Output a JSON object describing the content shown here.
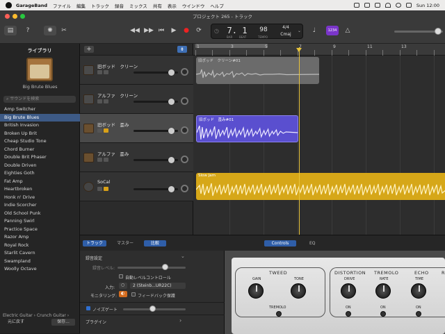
{
  "menubar": {
    "app_name": "GarageBand",
    "items": [
      "ファイル",
      "編集",
      "トラック",
      "録音",
      "ミックス",
      "共有",
      "表示",
      "ウインドウ",
      "ヘルプ"
    ],
    "clock": "Sun 12:00"
  },
  "toolbar": {
    "title": "プロジェクト 265 - トラック",
    "lcd": {
      "position": "7. 1",
      "bar_label": "BAR",
      "beat_label": "BEAT",
      "tempo": "98",
      "tempo_label": "TEMPO",
      "time_signature": "4/4",
      "key": "Cmaj"
    },
    "count_in": "1234"
  },
  "library": {
    "header": "ライブラリ",
    "patch_name": "Big Brute Blues",
    "search_placeholder": "サウンドを検索",
    "items": [
      "Amp Switcher",
      "Big Brute Blues",
      "British Invasion",
      "Broken Up Brit",
      "Cheap Studio Tone",
      "Chord Burner",
      "Double Brit Phaser",
      "Double Driven",
      "Eighties Goth",
      "Fat Amp",
      "Heartbroken",
      "Honk n' Drive",
      "Indie Scorcher",
      "Old School Punk",
      "Panning Swirl",
      "Practice Space",
      "Razor Amp",
      "Royal Rock",
      "Starlit Cavern",
      "Swampland",
      "Woolly Octave"
    ],
    "selected_index": 1,
    "breadcrumb": "Electric Guitar › Crunch Guitar ›",
    "revert_label": "元に戻す",
    "save_label": "保存..."
  },
  "tracks": [
    {
      "name": "旧ボッド　クリーン",
      "selected": false
    },
    {
      "name": "アルファ　クリーン",
      "selected": false
    },
    {
      "name": "旧ボッド　歪み",
      "selected": true
    },
    {
      "name": "アルファ　歪み",
      "selected": false
    },
    {
      "name": "SoCal",
      "selected": false
    }
  ],
  "ruler": {
    "bars": [
      "1",
      "3",
      "5",
      "7",
      "9",
      "11",
      "13"
    ],
    "playhead_bar": 7
  },
  "regions": [
    {
      "label": "旧ボッド　クリーン#01",
      "color": "#6b6b6b",
      "track": 0
    },
    {
      "label": "旧ボッド　歪み#01",
      "color": "#5a4fcf",
      "track": 2
    },
    {
      "label": "Slow Jam",
      "color": "#d6a718",
      "track": 4
    }
  ],
  "bottom": {
    "tabs": {
      "track": "トラック",
      "master": "マスター",
      "compare": "比較"
    },
    "view_tabs": {
      "controls": "Controls",
      "eq": "EQ"
    },
    "recording_settings": "録音設定",
    "record_level": "録音レベル:",
    "auto_level": "自動レベルコントロール",
    "input_label": "入力:",
    "input_value": "2 (Steinb...UR22C)",
    "monitoring_label": "モニタリング:",
    "feedback_protection": "フィードバック保護",
    "noise_gate": "ノイズゲート",
    "plugins": "プラグイン"
  },
  "amp": {
    "tweed": "TWEED",
    "gain": "GAIN",
    "tone": "TONE",
    "tremolo": "TREMOLO",
    "distortion": "DISTORTION",
    "drive": "DRIVE",
    "rate": "RATE",
    "echo": "ECHO",
    "time": "TIME",
    "on": "ON",
    "r_partial": "R"
  }
}
